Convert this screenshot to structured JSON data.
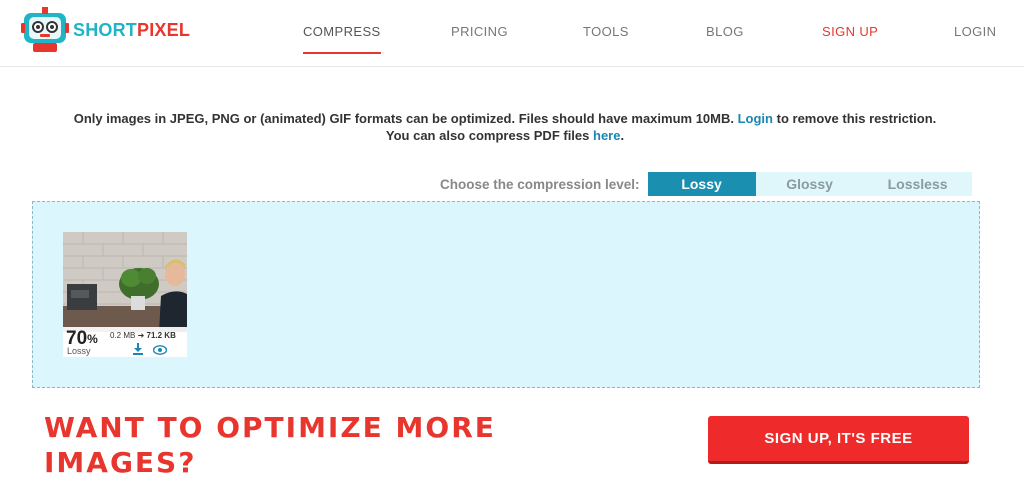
{
  "brand": {
    "name_part1": "SHORT",
    "name_part2": "PIXEL",
    "logo_icon": "robot-logo-icon"
  },
  "nav": {
    "compress": "COMPRESS",
    "pricing": "PRICING",
    "tools": "TOOLS",
    "blog": "BLOG",
    "signup": "SIGN UP",
    "login": "LOGIN"
  },
  "notice": {
    "line1_text": "Only images in JPEG, PNG or (animated) GIF formats can be optimized. Files should have maximum 10MB.",
    "line1_link": "Login",
    "line1_after": "to remove this restriction.",
    "line2_text": "You can also compress PDF files",
    "line2_link": "here",
    "line2_after": "."
  },
  "compression": {
    "label": "Choose the compression level:",
    "options": [
      "Lossy",
      "Glossy",
      "Lossless"
    ],
    "selected": "Lossy"
  },
  "result": {
    "percent": "70",
    "percent_sign": "%",
    "mode": "Lossy",
    "original_size": "0.2 MB",
    "arrow": "➜",
    "compressed_size": "71.2 KB"
  },
  "cta": {
    "headline": "WANT TO OPTIMIZE MORE IMAGES?",
    "button": "SIGN UP, IT'S FREE"
  },
  "colors": {
    "accent_red": "#e8362e",
    "brand_teal": "#1fb5c6",
    "selected_blue": "#1a8fb0",
    "dropzone_bg": "#dbf7fd"
  }
}
